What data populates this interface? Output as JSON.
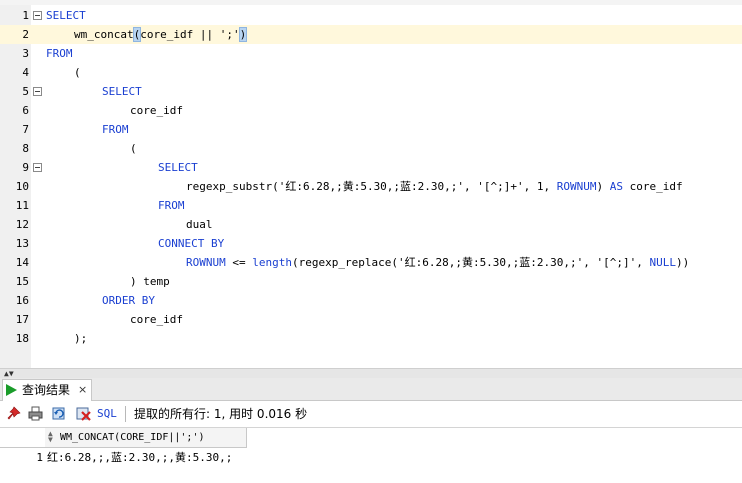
{
  "editor": {
    "line_numbers": [
      "1",
      "2",
      "3",
      "4",
      "5",
      "6",
      "7",
      "8",
      "9",
      "10",
      "11",
      "12",
      "13",
      "14",
      "15",
      "16",
      "17",
      "18"
    ],
    "lines": [
      {
        "kw1": "SELECT"
      },
      {
        "pre": "wm_concat",
        "hl": "(",
        "mid": "core_idf || ';'",
        "hl2": ")"
      },
      {
        "kw1": "FROM"
      },
      {
        "t1": "("
      },
      {
        "kw1": "SELECT"
      },
      {
        "t1": "core_idf"
      },
      {
        "kw1": "FROM"
      },
      {
        "t1": "("
      },
      {
        "kw1": "SELECT"
      },
      {
        "t1": "regexp_substr('红:6.28,;黄:5.30,;蓝:2.30,;', '[^;]+', 1, ",
        "kw2": "ROWNUM",
        ") AS core_idf": "",
        "t2": ") ",
        "kw3": "AS",
        "t3": " core_idf"
      },
      {
        "kw1": "FROM"
      },
      {
        "t1": "dual"
      },
      {
        "kw1": "CONNECT BY"
      },
      {
        "kw2": "ROWNUM",
        "t2": " <= ",
        "kw3": "length",
        "t3": "(regexp_replace('红:6.28,;黄:5.30,;蓝:2.30,;', '[^;]', ",
        "kw4": "NULL",
        "t4": "))"
      },
      {
        "t1": ") temp"
      },
      {
        "kw1": "ORDER BY"
      },
      {
        "t1": "core_idf"
      },
      {
        "t1": ");"
      }
    ]
  },
  "results": {
    "tab_label": "查询结果",
    "tab_close": "×",
    "toolbar": {
      "sql_label": "SQL",
      "status_text": "提取的所有行: 1, 用时 0.016 秒"
    },
    "grid": {
      "columns": [
        "WM_CONCAT(CORE_IDF||';')"
      ],
      "rows": [
        {
          "num": "1",
          "values": [
            "红:6.28,;,蓝:2.30,;,黄:5.30,;"
          ]
        }
      ]
    }
  },
  "colors": {
    "keyword": "#1a3fd1",
    "current_line": "#fff8dc",
    "run_icon": "#1a9c2a"
  },
  "icons": [
    "fold-toggle-icon",
    "run-icon",
    "pin-icon",
    "print-icon",
    "refresh-icon",
    "cancel-icon",
    "sort-icon"
  ]
}
